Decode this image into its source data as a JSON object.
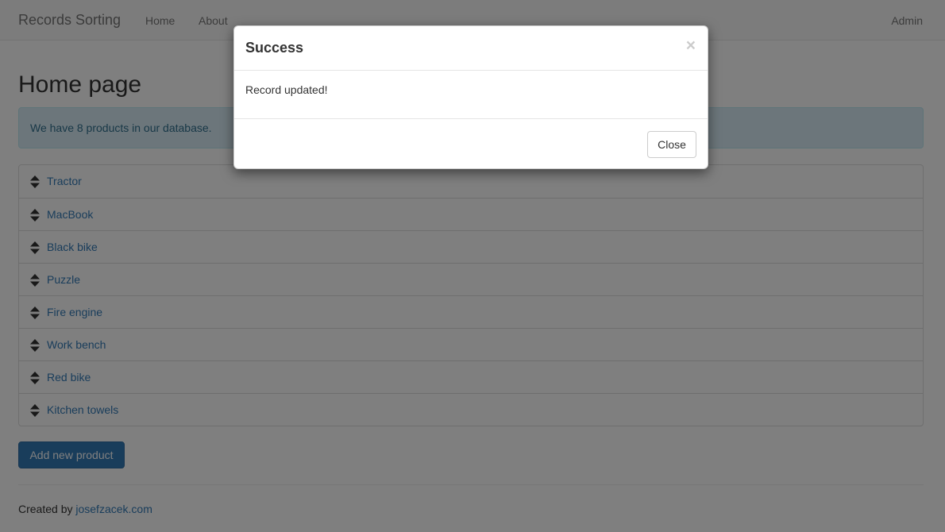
{
  "navbar": {
    "brand": "Records Sorting",
    "links": [
      "Home",
      "About"
    ],
    "user": "Admin"
  },
  "main": {
    "title": "Home page",
    "alert": "We have 8 products in our database.",
    "products": [
      "Tractor",
      "MacBook",
      "Black bike",
      "Puzzle",
      "Fire engine",
      "Work bench",
      "Red bike",
      "Kitchen towels"
    ],
    "add_button": "Add new product"
  },
  "footer": {
    "created_by": "Created by",
    "link": "josefzacek.com"
  },
  "modal": {
    "title": "Success",
    "close_x": "×",
    "body": "Record updated!",
    "close_button": "Close"
  },
  "icons": {
    "sort": "sort-icon",
    "close": "close-icon"
  },
  "colors": {
    "link": "#337ab7",
    "alert_bg": "#d9edf7",
    "alert_text": "#31708f",
    "primary_button": "#337ab7"
  }
}
